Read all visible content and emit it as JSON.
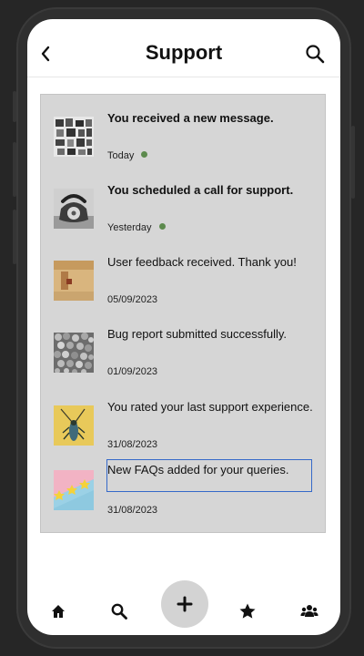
{
  "header": {
    "title": "Support",
    "back_icon": "chevron-left-icon",
    "search_icon": "search-icon"
  },
  "notifications": [
    {
      "title": "You received a new message.",
      "date": "Today",
      "unread": true,
      "bold": true,
      "thumb": "collage-photo"
    },
    {
      "title": "You scheduled a call for support.",
      "date": "Yesterday",
      "unread": true,
      "bold": true,
      "thumb": "rotary-phone-photo"
    },
    {
      "title": "User feedback received. Thank you!",
      "date": "05/09/2023",
      "unread": false,
      "bold": false,
      "thumb": "wall-photo"
    },
    {
      "title": "Bug report submitted successfully.",
      "date": "01/09/2023",
      "unread": false,
      "bold": false,
      "thumb": "pebbles-photo"
    },
    {
      "title": "You rated your last support experience.",
      "date": "31/08/2023",
      "unread": false,
      "bold": false,
      "thumb": "insect-photo"
    },
    {
      "title": "New FAQs added for your queries.",
      "date": "31/08/2023",
      "unread": false,
      "bold": false,
      "thumb": "stars-photo",
      "focused": true
    }
  ],
  "bottom_nav": {
    "items": [
      {
        "icon": "home-icon"
      },
      {
        "icon": "search-icon"
      },
      {
        "icon": "plus-icon"
      },
      {
        "icon": "star-icon"
      },
      {
        "icon": "group-icon"
      }
    ]
  },
  "colors": {
    "list_background": "#d6d6d6",
    "unread_dot": "#5c8a4d",
    "focus_outline": "#3569c9",
    "fab_background": "#d3d3d3"
  }
}
